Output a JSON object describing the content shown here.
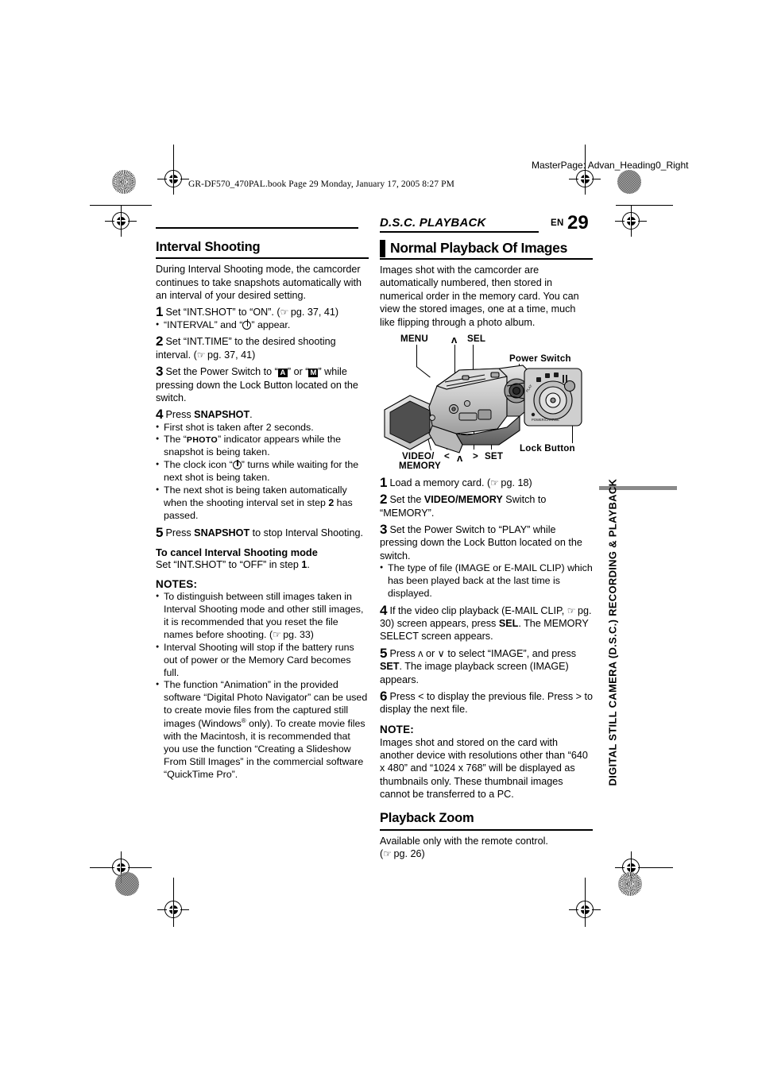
{
  "print_marks": {
    "slug_line": "GR-DF570_470PAL.book  Page 29  Monday, January 17, 2005  8:27 PM",
    "masterpage": "MasterPage: Advan_Heading0_Right"
  },
  "running_head": {
    "section_title": "D.S.C. PLAYBACK",
    "lang_code": "EN",
    "page_number": "29"
  },
  "side_tab": {
    "label": "DIGITAL STILL CAMERA (D.S.C.) RECORDING & PLAYBACK",
    "bar_color": "#8a8a8a"
  },
  "left_column": {
    "heading": "Interval Shooting",
    "intro": "During Interval Shooting mode, the camcorder continues to take snapshots automatically with an interval of your desired setting.",
    "steps": [
      {
        "n": "1",
        "text_a": "Set “INT.SHOT” to “ON”. (",
        "text_b": " pg. 37, 41)"
      },
      {
        "n": "2",
        "text_a": "Set “INT.TIME” to the desired shooting interval. (",
        "text_b": " pg. 37, 41)"
      },
      {
        "n": "3",
        "text_a": "Set the Power Switch to “",
        "icon_a": "A",
        "text_b": "” or “",
        "icon_b": "M",
        "text_c": "” while pressing down the Lock Button located on the switch."
      },
      {
        "n": "4",
        "text_a": "Press ",
        "bold": "SNAPSHOT",
        "text_b": "."
      },
      {
        "n": "5",
        "text_a": "Press ",
        "bold": "SNAPSHOT",
        "text_b": " to stop Interval Shooting."
      }
    ],
    "step1_bullet_a": "“INTERVAL” and “",
    "step1_bullet_b": "” appear.",
    "step4_bullets": [
      {
        "kind": "plain",
        "text": "First shot is taken after 2 seconds."
      },
      {
        "kind": "photo",
        "a": "The “",
        "icon": "PHOTO",
        "b": "” indicator appears while the snapshot is being taken."
      },
      {
        "kind": "clock",
        "a": "The clock icon “",
        "b": "” turns while waiting for the next shot is being taken."
      },
      {
        "kind": "stepref",
        "a": "The next shot is being taken automatically when the shooting interval set in step ",
        "num": "2",
        "b": " has passed."
      }
    ],
    "cancel_heading": "To cancel Interval Shooting mode",
    "cancel_text_a": "Set “INT.SHOT” to “OFF” in step ",
    "cancel_step": "1",
    "cancel_text_b": ".",
    "notes_heading": "NOTES:",
    "notes": [
      {
        "kind": "pgref",
        "a": "To distinguish between still images taken in Interval Shooting mode and other still images, it is recommended that you reset the file names before shooting. (",
        "b": " pg. 33)"
      },
      {
        "kind": "plain",
        "text": "Interval Shooting will stop if the battery runs out of power or the Memory Card becomes full."
      },
      {
        "kind": "windows",
        "a": "The function “Animation” in the provided software “Digital Photo Navigator” can be used to create movie files from the captured still images (Windows",
        "sup": "®",
        "b": " only). To create movie files with the Macintosh, it is recommended that you use the function “Creating a Slideshow From Still Images” in the commercial software “QuickTime Pro”."
      }
    ]
  },
  "right_column": {
    "heading": "Normal Playback Of Images",
    "intro": "Images shot with the camcorder are automatically numbered, then stored in numerical order in the memory card. You can view the stored images, one at a time, much like flipping through a photo album.",
    "figure": {
      "alt": "camcorder-diagram",
      "labels": [
        {
          "id": "menu",
          "text": "MENU"
        },
        {
          "id": "up",
          "text": "ʌ"
        },
        {
          "id": "sel",
          "text": "SEL"
        },
        {
          "id": "power-switch",
          "text": "Power Switch"
        },
        {
          "id": "lock-button",
          "text": "Lock Button"
        },
        {
          "id": "video",
          "text": "VIDEO/"
        },
        {
          "id": "memory",
          "text": "MEMORY"
        },
        {
          "id": "left",
          "text": "<"
        },
        {
          "id": "down",
          "text": "ʌ"
        },
        {
          "id": "right",
          "text": ">"
        },
        {
          "id": "set",
          "text": "SET"
        }
      ]
    },
    "steps": [
      {
        "n": "1",
        "text_a": "Load a memory card. (",
        "text_b": " pg. 18)"
      },
      {
        "n": "2",
        "text_a": "Set the ",
        "bold": "VIDEO/MEMORY",
        "text_b": " Switch to “MEMORY”."
      },
      {
        "n": "3",
        "text_a": "Set the Power Switch to “PLAY” while pressing down the Lock Button located on the switch."
      },
      {
        "n": "4",
        "text_a": "If the video clip playback (E-MAIL CLIP, ",
        "text_b": " pg. 30) screen appears, press ",
        "bold": "SEL",
        "text_c": ". The MEMORY SELECT screen appears."
      },
      {
        "n": "5",
        "text_a": "Press ʌ or ∨ to select “IMAGE”, and press ",
        "bold": "SET",
        "text_b": ". The image playback screen (IMAGE) appears."
      },
      {
        "n": "6",
        "text_a": "Press < to display the previous file. Press > to display the next file."
      }
    ],
    "step3_bullet": "The type of file (IMAGE or E-MAIL CLIP) which has been played back at the last time is displayed.",
    "note_heading": "NOTE:",
    "note_text": "Images shot and stored on the card with another device with resolutions other than “640 x 480” and “1024 x 768” will be displayed as thumbnails only. These thumbnail images cannot be transferred to a PC.",
    "zoom_heading": "Playback Zoom",
    "zoom_text_a": "Available only with the remote control.",
    "zoom_text_b": "(",
    "zoom_text_c": " pg. 26)"
  }
}
